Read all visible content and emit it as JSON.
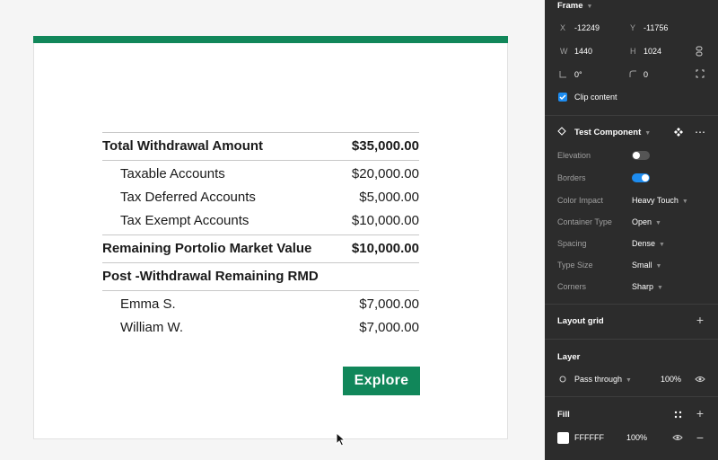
{
  "summary": {
    "total_label": "Total Withdrawal Amount",
    "total_value": "$35,000.00",
    "accounts": [
      {
        "label": "Taxable Accounts",
        "value": "$20,000.00"
      },
      {
        "label": "Tax Deferred Accounts",
        "value": "$5,000.00"
      },
      {
        "label": "Tax Exempt Accounts",
        "value": "$10,000.00"
      }
    ],
    "remaining_label": "Remaining Portolio Market Value",
    "remaining_value": "$10,000.00",
    "rmd_label": "Post -Withdrawal Remaining RMD",
    "people": [
      {
        "label": "Emma S.",
        "value": "$7,000.00"
      },
      {
        "label": "William W.",
        "value": "$7,000.00"
      }
    ],
    "explore_label": "Explore"
  },
  "colors": {
    "accent": "#11875a",
    "panel_bg": "#2c2c2c",
    "toggle_on": "#1d8cf0"
  },
  "panel": {
    "frame": {
      "title": "Frame",
      "x_label": "X",
      "x_value": "-12249",
      "y_label": "Y",
      "y_value": "-11756",
      "w_label": "W",
      "w_value": "1440",
      "h_label": "H",
      "h_value": "1024",
      "rotation_value": "0°",
      "radius_value": "0",
      "clip_content_label": "Clip content",
      "clip_content_checked": true
    },
    "component": {
      "name": "Test Component",
      "props": [
        {
          "label": "Elevation",
          "type": "toggle",
          "value": false
        },
        {
          "label": "Borders",
          "type": "toggle",
          "value": true
        },
        {
          "label": "Color Impact",
          "type": "select",
          "value": "Heavy Touch"
        },
        {
          "label": "Container Type",
          "type": "select",
          "value": "Open"
        },
        {
          "label": "Spacing",
          "type": "select",
          "value": "Dense"
        },
        {
          "label": "Type Size",
          "type": "select",
          "value": "Small"
        },
        {
          "label": "Corners",
          "type": "select",
          "value": "Sharp"
        }
      ]
    },
    "layout_grid": {
      "title": "Layout grid"
    },
    "layer": {
      "title": "Layer",
      "blend_mode": "Pass through",
      "opacity": "100%"
    },
    "fill": {
      "title": "Fill",
      "hex": "FFFFFF",
      "opacity": "100%"
    }
  }
}
